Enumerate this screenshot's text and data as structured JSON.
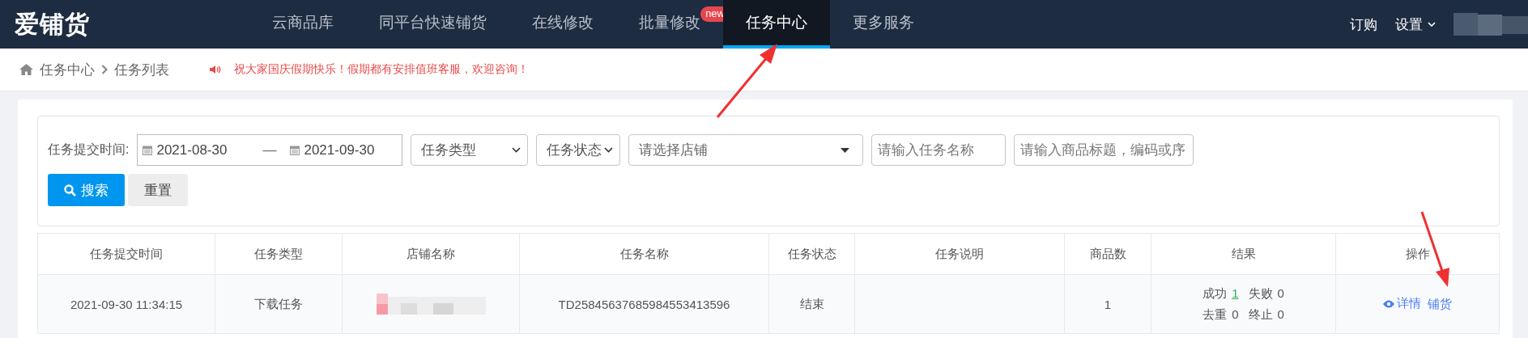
{
  "header": {
    "logo": "爱铺货",
    "nav": [
      {
        "label": "云商品库",
        "selected": false
      },
      {
        "label": "同平台快速铺货",
        "selected": false
      },
      {
        "label": "在线修改",
        "selected": false
      },
      {
        "label": "批量修改",
        "selected": false,
        "badge": "new"
      },
      {
        "label": "任务中心",
        "selected": true
      },
      {
        "label": "更多服务",
        "selected": false
      }
    ],
    "right": [
      {
        "label": "订购",
        "kind": "link"
      },
      {
        "label": "设置",
        "kind": "menu"
      }
    ]
  },
  "breadcrumb": [
    "任务中心",
    "任务列表"
  ],
  "notice": "祝大家国庆假期快乐！假期都有安排值班客服，欢迎咨询！",
  "filters": {
    "date_label": "任务提交时间:",
    "date_from": "2021-08-30",
    "separator": "—",
    "date_to": "2021-09-30",
    "selects": [
      {
        "value": "任务类型",
        "kind": "native"
      },
      {
        "value": "任务状态",
        "kind": "native"
      },
      {
        "placeholder": "请选择店铺",
        "kind": "dropdown"
      }
    ],
    "inputs": [
      {
        "placeholder": "请输入任务名称"
      },
      {
        "placeholder": "请输入商品标题，编码或序"
      }
    ],
    "buttons": [
      {
        "label": "搜索",
        "kind": "primary"
      },
      {
        "label": "重置",
        "kind": "default"
      }
    ]
  },
  "table": {
    "columns": [
      "任务提交时间",
      "任务类型",
      "店铺名称",
      "任务名称",
      "任务状态",
      "任务说明",
      "商品数",
      "结果",
      "操作"
    ],
    "rows": [
      {
        "time": "2021-09-30 11:34:15",
        "type": "下载任务",
        "task_name": "TD25845637685984553413596",
        "status": "结束",
        "count": "1",
        "results": [
          {
            "label": "成功",
            "value": "1",
            "kind": "link"
          },
          {
            "label": "失败",
            "value": "0",
            "kind": "plain"
          },
          {
            "label": "去重",
            "value": "0",
            "kind": "plain"
          },
          {
            "label": "终止",
            "value": "0",
            "kind": "plain"
          }
        ],
        "actions": [
          {
            "label": "详情",
            "kind": "view"
          },
          {
            "label": "铺货",
            "kind": "plain"
          }
        ]
      }
    ]
  }
}
